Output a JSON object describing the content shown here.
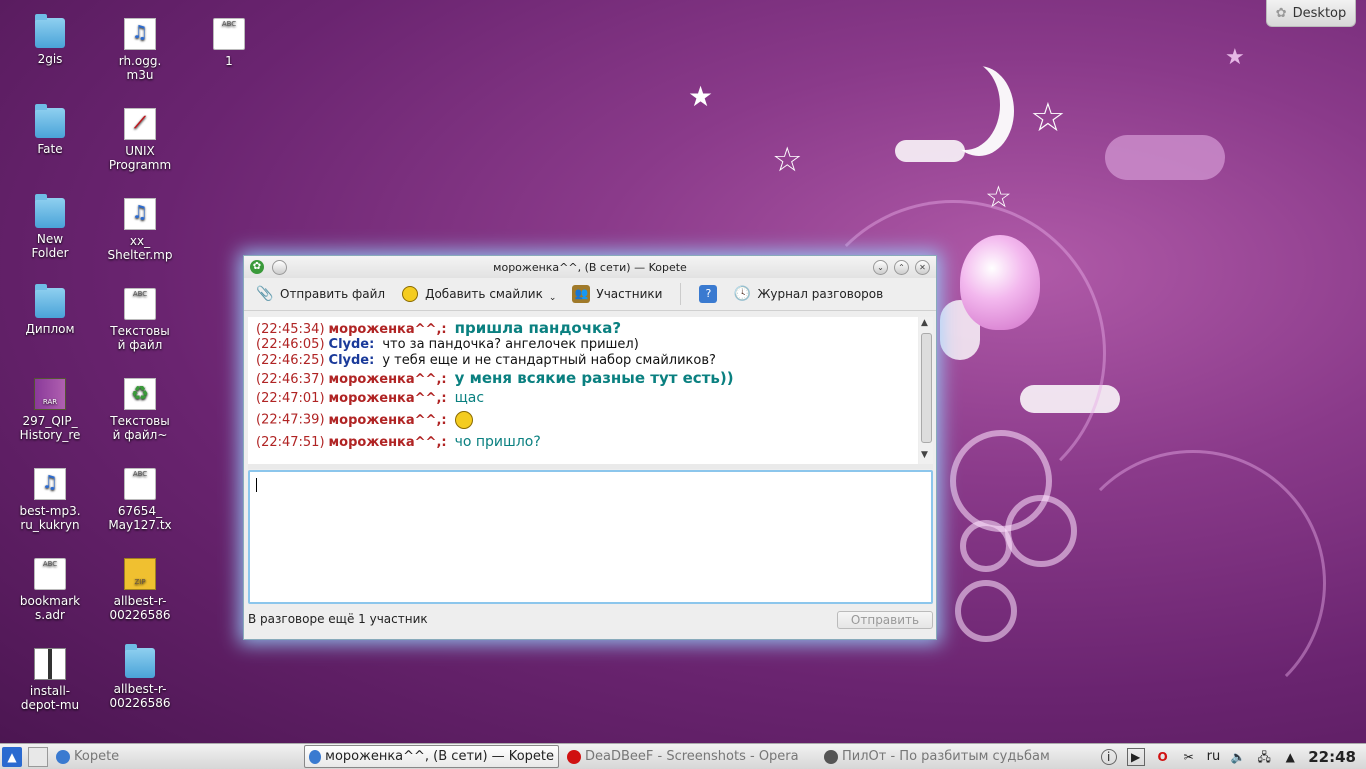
{
  "desktop_button": {
    "label": "Desktop",
    "icon": "plasma-cashew-icon"
  },
  "desktop_icons": [
    {
      "label": "2gis",
      "type": "folder"
    },
    {
      "label": "rh.ogg.\nm3u",
      "type": "music"
    },
    {
      "label": "1",
      "type": "doc",
      "badge": "ABC"
    },
    {
      "label": "Fate",
      "type": "folder"
    },
    {
      "label": "UNIX\nProgramm",
      "type": "pdf"
    },
    {
      "label": "New\nFolder",
      "type": "folder"
    },
    {
      "label": "xx_\nShelter.mp",
      "type": "music"
    },
    {
      "label": "Диплом",
      "type": "folder"
    },
    {
      "label": "Текстовы\nй файл",
      "type": "doc",
      "badge": "ABC"
    },
    {
      "label": "297_QIP_\nHistory_re",
      "type": "rar",
      "badge": "RAR"
    },
    {
      "label": "Текстовы\nй файл~",
      "type": "recycle"
    },
    {
      "label": "best-mp3.\nru_kukryn",
      "type": "music"
    },
    {
      "label": "67654_\nMay127.tx",
      "type": "doc",
      "badge": "ABC"
    },
    {
      "label": "bookmark\ns.adr",
      "type": "doc",
      "badge": "ABC"
    },
    {
      "label": "allbest-r-\n00226586",
      "type": "zip",
      "badge": "ZIP"
    },
    {
      "label": "install-\ndepot-mu",
      "type": "pkg"
    },
    {
      "label": "allbest-r-\n00226586",
      "type": "folder"
    }
  ],
  "window": {
    "title": "мороженка^^, (В сети) — Kopete",
    "toolbar": {
      "send_file": "Отправить файл",
      "add_smiley": "Добавить смайлик",
      "participants": "Участники",
      "history": "Журнал разговоров"
    },
    "messages": [
      {
        "time": "(22:45:34)",
        "nick": "мороженка^^,:",
        "text": "пришла пандочка?",
        "style": "big",
        "from": "m"
      },
      {
        "time": "(22:46:05)",
        "nick": "Clyde:",
        "text": "что за пандочка? ангелочек пришел)",
        "style": "plain",
        "from": "c"
      },
      {
        "time": "(22:46:25)",
        "nick": "Clyde:",
        "text": "у тебя еще и не стандартный набор смайликов?",
        "style": "plain",
        "from": "c"
      },
      {
        "time": "(22:46:37)",
        "nick": "мороженка^^,:",
        "text": "у меня всякие разные тут есть))",
        "style": "big",
        "from": "m"
      },
      {
        "time": "(22:47:01)",
        "nick": "мороженка^^,:",
        "text": "щас",
        "style": "thin",
        "from": "m"
      },
      {
        "time": "(22:47:39)",
        "nick": "мороженка^^,:",
        "text": "",
        "style": "smiley",
        "from": "m"
      },
      {
        "time": "(22:47:51)",
        "nick": "мороженка^^,:",
        "text": "чо пришло?",
        "style": "thin",
        "from": "m"
      }
    ],
    "input_value": "",
    "status_text": "В разговоре ещё 1 участник",
    "send_button": "Отправить"
  },
  "taskbar": {
    "tasks": [
      {
        "label": "Kopete",
        "active": false,
        "muted": true,
        "icon": "kopete-icon"
      },
      {
        "label": "мороженка^^, (В сети) — Kopete",
        "active": true,
        "muted": false,
        "icon": "kopete-icon"
      },
      {
        "label": "DeaDBeeF - Screenshots - Opera",
        "active": false,
        "muted": true,
        "icon": "opera-icon"
      },
      {
        "label": "ПилОт - По разбитым судьбам",
        "active": false,
        "muted": true,
        "icon": "player-icon"
      }
    ],
    "layout": "ru",
    "clock": "22:48"
  },
  "colors": {
    "accent": "#8cc6ec",
    "nick_self": "#b02424",
    "nick_peer": "#1a3a9a",
    "text_teal": "#0a8080"
  }
}
